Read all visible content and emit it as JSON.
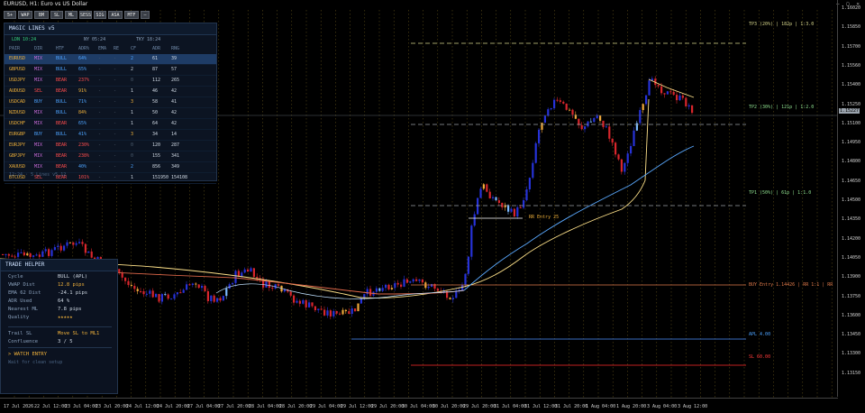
{
  "window": {
    "title": "EURUSD, H1: Euro vs US Dollar",
    "controls": "– ▢ ✕"
  },
  "toolbar": {
    "buttons": [
      "5+",
      "WAP",
      "BM",
      "SL",
      "ML",
      "SESS",
      "SIG",
      "ASA",
      "MTF",
      "—"
    ]
  },
  "panel": {
    "title": "MAGIC LINES v5",
    "sessions": [
      {
        "label": "LDN 10:24",
        "color": "#35d07f"
      },
      {
        "label": "NY 05:24",
        "color": "#8aa0bb"
      },
      {
        "label": "TKY 18:24",
        "color": "#8aa0bb"
      }
    ],
    "columns": [
      "PAIR",
      "DIR",
      "HTF",
      "ADR%",
      "EMA",
      "RE",
      "CF",
      "ADR",
      "RNG"
    ],
    "rows": [
      {
        "pair": "EURUSD",
        "dir": "MIX",
        "htf": "BULL",
        "adr": "64%",
        "ema": "-",
        "re": "-",
        "cf": "2",
        "a": "61",
        "rng": "39",
        "pc": "#f0b13a",
        "dc": "#c86bd8",
        "hc": "#4da3ff",
        "ac": "#4da3ff",
        "cc": "#4da3ff",
        "sel": true
      },
      {
        "pair": "GBPUSD",
        "dir": "MIX",
        "htf": "BULL",
        "adr": "65%",
        "ema": "-",
        "re": "-",
        "cf": "2",
        "a": "87",
        "rng": "57",
        "pc": "#f0b13a",
        "dc": "#c86bd8",
        "hc": "#4da3ff",
        "ac": "#4da3ff",
        "cc": "#cfd8e3"
      },
      {
        "pair": "USDJPY",
        "dir": "MIX",
        "htf": "BEAR",
        "adr": "237%",
        "ema": "-",
        "re": "-",
        "cf": "0",
        "a": "112",
        "rng": "265",
        "pc": "#f0b13a",
        "dc": "#c86bd8",
        "hc": "#ff4d4d",
        "ac": "#ff4d4d",
        "cc": "#4d5d70"
      },
      {
        "pair": "AUDUSD",
        "dir": "SEL",
        "htf": "BEAR",
        "adr": "91%",
        "ema": "-",
        "re": "-",
        "cf": "1",
        "a": "46",
        "rng": "42",
        "pc": "#f0b13a",
        "dc": "#ff4d4d",
        "hc": "#ff4d4d",
        "ac": "#f0b13a",
        "cc": "#cfd8e3"
      },
      {
        "pair": "USDCAD",
        "dir": "BUY",
        "htf": "BULL",
        "adr": "71%",
        "ema": "-",
        "re": "-",
        "cf": "3",
        "a": "58",
        "rng": "41",
        "pc": "#f0b13a",
        "dc": "#4da3ff",
        "hc": "#4da3ff",
        "ac": "#4da3ff",
        "cc": "#f0b13a"
      },
      {
        "pair": "NZDUSD",
        "dir": "MIX",
        "htf": "BULL",
        "adr": "84%",
        "ema": "-",
        "re": "-",
        "cf": "1",
        "a": "50",
        "rng": "42",
        "pc": "#f0b13a",
        "dc": "#c86bd8",
        "hc": "#4da3ff",
        "ac": "#f0b13a",
        "cc": "#cfd8e3"
      },
      {
        "pair": "USDCHF",
        "dir": "MIX",
        "htf": "BEAR",
        "adr": "65%",
        "ema": "-",
        "re": "-",
        "cf": "1",
        "a": "64",
        "rng": "42",
        "pc": "#f0b13a",
        "dc": "#c86bd8",
        "hc": "#ff4d4d",
        "ac": "#4da3ff",
        "cc": "#cfd8e3"
      },
      {
        "pair": "EURGBP",
        "dir": "BUY",
        "htf": "BULL",
        "adr": "41%",
        "ema": "-",
        "re": "-",
        "cf": "3",
        "a": "34",
        "rng": "14",
        "pc": "#f0b13a",
        "dc": "#4da3ff",
        "hc": "#4da3ff",
        "ac": "#4da3ff",
        "cc": "#f0b13a"
      },
      {
        "pair": "EURJPY",
        "dir": "MIX",
        "htf": "BEAR",
        "adr": "230%",
        "ema": "-",
        "re": "-",
        "cf": "0",
        "a": "120",
        "rng": "287",
        "pc": "#f0b13a",
        "dc": "#c86bd8",
        "hc": "#ff4d4d",
        "ac": "#ff4d4d",
        "cc": "#4d5d70"
      },
      {
        "pair": "GBPJPY",
        "dir": "MIX",
        "htf": "BEAR",
        "adr": "238%",
        "ema": "-",
        "re": "-",
        "cf": "0",
        "a": "155",
        "rng": "341",
        "pc": "#f0b13a",
        "dc": "#c86bd8",
        "hc": "#ff4d4d",
        "ac": "#ff4d4d",
        "cc": "#4d5d70"
      },
      {
        "pair": "XAUUSD",
        "dir": "MIX",
        "htf": "BEAR",
        "adr": "40%",
        "ema": "-",
        "re": "-",
        "cf": "2",
        "a": "856",
        "rng": "349",
        "pc": "#f0b13a",
        "dc": "#c86bd8",
        "hc": "#ff4d4d",
        "ac": "#4da3ff",
        "cc": "#4da3ff"
      },
      {
        "pair": "BTCUSD",
        "dir": "SEL",
        "htf": "BEAR",
        "adr": "101%",
        "ema": "-",
        "re": "-",
        "cf": "1",
        "a": "151950",
        "rng": "154108",
        "pc": "#f0b13a",
        "dc": "#ff4d4d",
        "hc": "#ff4d4d",
        "ac": "#ff4d4d",
        "cc": "#cfd8e3"
      }
    ],
    "footer": "12:24 · 5 Lines v5.12"
  },
  "trade_helper": {
    "title": "TRADE HELPER",
    "rows": [
      {
        "k": "Cycle",
        "v": "BULL (APL)",
        "c": "#cfd8e3"
      },
      {
        "k": "VWAP Dist",
        "v": "12.8 pips",
        "c": "#f0b13a"
      },
      {
        "k": "EMA 62 Dist",
        "v": "-24.1 pips",
        "c": "#cfd8e3"
      },
      {
        "k": "ADR Used",
        "v": "64 %",
        "c": "#cfd8e3"
      },
      {
        "k": "Nearest ML",
        "v": "7.8 pips",
        "c": "#cfd8e3"
      },
      {
        "k": "Quality",
        "v": "★★★★★",
        "c": "#f0b13a"
      },
      {
        "k": "Trail SL",
        "v": "Move SL to ML1",
        "c": "#f0b13a"
      },
      {
        "k": "Confluence",
        "v": "3 / 5",
        "c": "#cfd8e3"
      }
    ],
    "action": "> WATCH ENTRY",
    "hint": "Wait for clean setup"
  },
  "levels": [
    {
      "label": "TP3 (20%) | 182p | 1:3.0",
      "color": "#d4d48a"
    },
    {
      "label": "TP2 (30%) | 121p | 1:2.0",
      "color": "#8fe08f"
    },
    {
      "label": "TP1 (50%) | 61p | 1:1.0",
      "color": "#8fe08f"
    },
    {
      "label": "BUY Entry 1.14426 | RR 1:1 | RR",
      "color": "#e07a4a"
    },
    {
      "label": "APL 4.00",
      "color": "#4da3ff"
    },
    {
      "label": "SL 60.00",
      "color": "#ff3b3b"
    },
    {
      "label": "RR Entry 25",
      "color": "#f0b13a"
    }
  ],
  "price_axis": [
    "1.16020",
    "1.15850",
    "1.15700",
    "1.15560",
    "1.15400",
    "1.15250",
    "1.15100",
    "1.14950",
    "1.14800",
    "1.14650",
    "1.14500",
    "1.14350",
    "1.14200",
    "1.14050",
    "1.13900",
    "1.13750",
    "1.13600",
    "1.13450",
    "1.13300",
    "1.13150"
  ],
  "current_price": "1.15227",
  "time_axis": [
    "17 Jul 2026",
    "22 Jul 12:00",
    "23 Jul 04:00",
    "23 Jul 20:00",
    "24 Jul 12:00",
    "24 Jul 20:00",
    "27 Jul 04:00",
    "27 Jul 20:00",
    "28 Jul 04:00",
    "28 Jul 20:00",
    "29 Jul 04:00",
    "29 Jul 12:00",
    "29 Jul 20:00",
    "30 Jul 04:00",
    "30 Jul 20:00",
    "29 Jul 20:00",
    "31 Jul 04:00",
    "31 Jul 12:00",
    "31 Jul 20:00",
    "1 Aug 04:00",
    "1 Aug 20:00",
    "3 Aug 04:00",
    "3 Aug 12:00"
  ]
}
